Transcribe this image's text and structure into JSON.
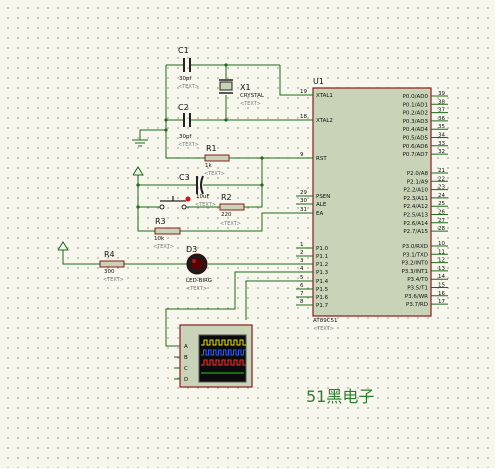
{
  "components": {
    "c1": {
      "ref": "C1",
      "value": "30pf",
      "text": "<TEXT>"
    },
    "c2": {
      "ref": "C2",
      "value": "30pf",
      "text": "<TEXT>"
    },
    "x1": {
      "ref": "X1",
      "value": "CRYSTAL",
      "text": "<TEXT>"
    },
    "r1": {
      "ref": "R1",
      "value": "1k",
      "text": "<TEXT>"
    },
    "c3": {
      "ref": "C3",
      "value": "10uF",
      "text": "<TEXT>"
    },
    "r2": {
      "ref": "R2",
      "value": "220",
      "text": "<TEXT>"
    },
    "r3": {
      "ref": "R3",
      "value": "10k",
      "text": "<TEXT>"
    },
    "r4": {
      "ref": "R4",
      "value": "300",
      "text": "<TEXT>"
    },
    "d3": {
      "ref": "D3",
      "value": "LED-BIRG",
      "text": "<TEXT>"
    },
    "u1": {
      "ref": "U1",
      "part": "AT89C51",
      "text": "<TEXT>"
    }
  },
  "mcu_left_pins": [
    {
      "num": "19",
      "name": "XTAL1"
    },
    {
      "num": "18",
      "name": "XTAL2"
    },
    {
      "num": "9",
      "name": "RST"
    },
    {
      "num": "29",
      "name": "PSEN"
    },
    {
      "num": "30",
      "name": "ALE"
    },
    {
      "num": "31",
      "name": "EA"
    },
    {
      "num": "1",
      "name": "P1.0"
    },
    {
      "num": "2",
      "name": "P1.1"
    },
    {
      "num": "3",
      "name": "P1.2"
    },
    {
      "num": "4",
      "name": "P1.3"
    },
    {
      "num": "5",
      "name": "P1.4"
    },
    {
      "num": "6",
      "name": "P1.5"
    },
    {
      "num": "7",
      "name": "P1.6"
    },
    {
      "num": "8",
      "name": "P1.7"
    }
  ],
  "mcu_right_pins": [
    {
      "num": "39",
      "name": "P0.0/AD0"
    },
    {
      "num": "38",
      "name": "P0.1/AD1"
    },
    {
      "num": "37",
      "name": "P0.2/AD2"
    },
    {
      "num": "36",
      "name": "P0.3/AD3"
    },
    {
      "num": "35",
      "name": "P0.4/AD4"
    },
    {
      "num": "34",
      "name": "P0.5/AD5"
    },
    {
      "num": "33",
      "name": "P0.6/AD6"
    },
    {
      "num": "32",
      "name": "P0.7/AD7"
    },
    {
      "num": "21",
      "name": "P2.0/A8"
    },
    {
      "num": "22",
      "name": "P2.1/A9"
    },
    {
      "num": "23",
      "name": "P2.2/A10"
    },
    {
      "num": "24",
      "name": "P2.3/A11"
    },
    {
      "num": "25",
      "name": "P2.4/A12"
    },
    {
      "num": "26",
      "name": "P2.5/A13"
    },
    {
      "num": "27",
      "name": "P2.6/A14"
    },
    {
      "num": "28",
      "name": "P2.7/A15"
    },
    {
      "num": "10",
      "name": "P3.0/RXD"
    },
    {
      "num": "11",
      "name": "P3.1/TXD"
    },
    {
      "num": "12",
      "name": "P3.2/INT0"
    },
    {
      "num": "13",
      "name": "P3.3/INT1"
    },
    {
      "num": "14",
      "name": "P3.4/T0"
    },
    {
      "num": "15",
      "name": "P3.5/T1"
    },
    {
      "num": "16",
      "name": "P3.6/WR"
    },
    {
      "num": "17",
      "name": "P3.7/RD"
    }
  ],
  "oscilloscope": {
    "channels": [
      "A",
      "B",
      "C",
      "D"
    ],
    "trace_colors": [
      "#e8e800",
      "#2b5cff",
      "#ff3030",
      "#22cc22"
    ]
  },
  "watermark": "51黑电子",
  "colors": {
    "wire": "#1b6b1b",
    "component": "#8b1a1a",
    "fill": "#c9d3b8"
  }
}
